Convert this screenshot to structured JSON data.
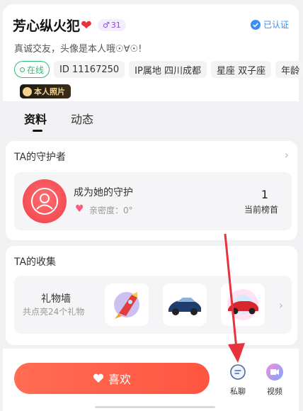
{
  "profile": {
    "name": "芳心纵火犯",
    "name_emoji": "❤",
    "level": "31",
    "verified": "已认证",
    "bio": "真诚交友，头像是本人哦☉∀☉!",
    "online": "在线",
    "tags": [
      "ID 11167250",
      "IP属地 四川成都",
      "星座 双子座",
      "年龄"
    ],
    "photo_badge": "本人照片"
  },
  "tabs": [
    {
      "label": "资料",
      "active": true
    },
    {
      "label": "动态",
      "active": false
    }
  ],
  "guardian": {
    "section_title": "TA的守护者",
    "title": "成为她的守护",
    "intimacy": "亲密度：0°",
    "rank_value": "1",
    "rank_label": "当前榜首"
  },
  "collection": {
    "section_title": "TA的收集",
    "gift_title": "礼物墙",
    "gift_sub": "共点亮24个礼物",
    "gifts": [
      "rocket-gift",
      "car-gift",
      "sports-car-gift"
    ]
  },
  "bottom": {
    "like": "喜欢",
    "chat": "私聊",
    "video": "视频"
  },
  "colors": {
    "accent": "#ff5a44",
    "online": "#2ebd72",
    "verified": "#3a8ef6",
    "annotation_arrow": "#e8323c"
  }
}
